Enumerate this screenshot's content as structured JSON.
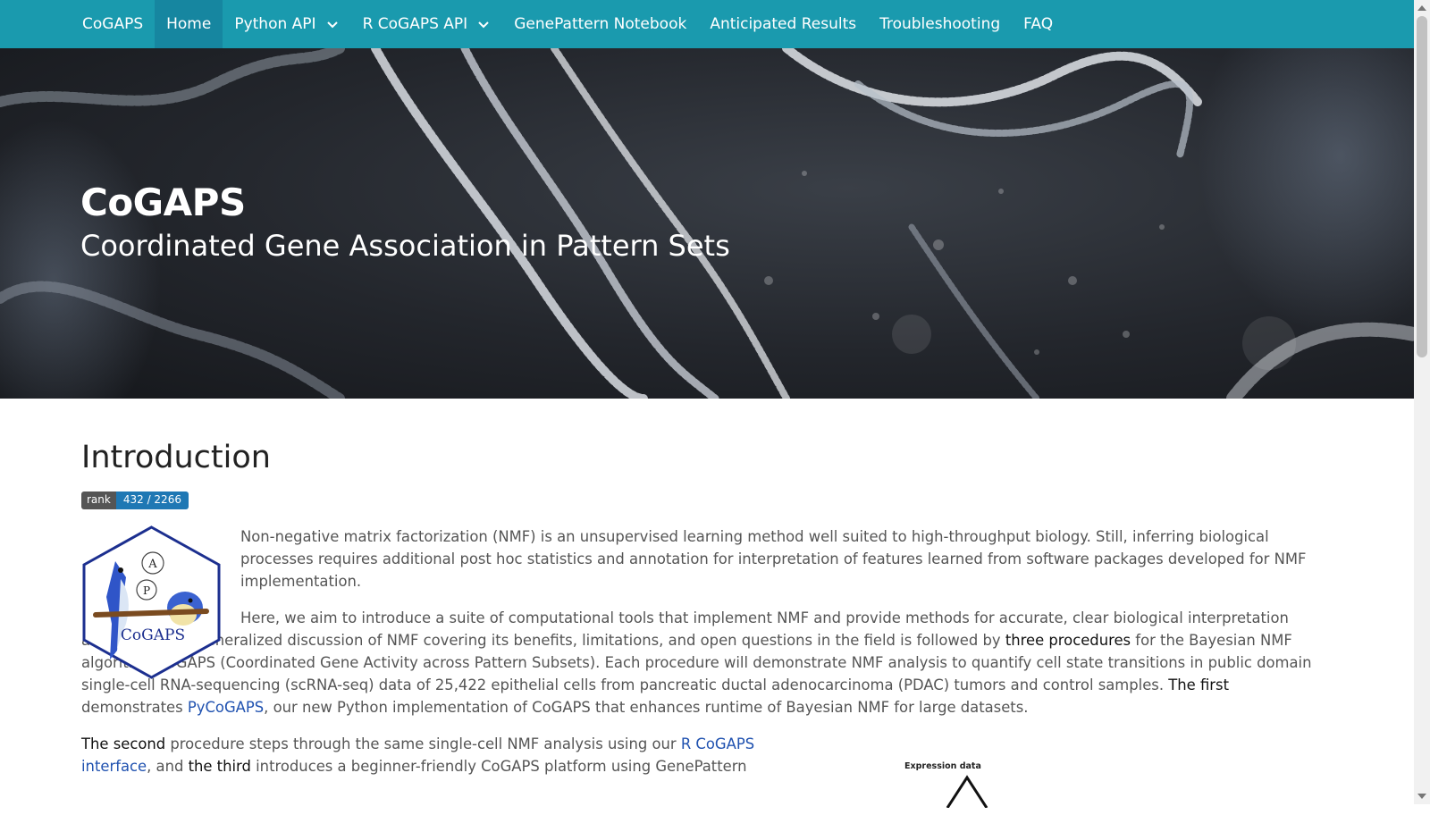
{
  "nav": {
    "brand": "CoGAPS",
    "items": [
      {
        "label": "Home",
        "active": true
      },
      {
        "label": "Python API",
        "dropdown": true
      },
      {
        "label": "R CoGAPS API",
        "dropdown": true
      },
      {
        "label": "GenePattern Notebook"
      },
      {
        "label": "Anticipated Results"
      },
      {
        "label": "Troubleshooting"
      },
      {
        "label": "FAQ"
      }
    ]
  },
  "hero": {
    "title": "CoGAPS",
    "subtitle": "Coordinated Gene Association in Pattern Sets"
  },
  "intro": {
    "heading": "Introduction",
    "badge_label": "rank",
    "badge_value": "432 / 2266",
    "logo_text": "CoGAPS",
    "logo_letters": [
      "A",
      "P"
    ],
    "p1": "Non-negative matrix factorization (NMF) is an unsupervised learning method well suited to high-throughput biology. Still, inferring biological processes requires additional post hoc statistics and annotation for interpretation of features learned from software packages developed for NMF implementation.",
    "p2_a": "Here, we aim to introduce a suite of computational tools that implement NMF and provide methods for accurate, clear biological interpretation and analysis. A generalized discussion of NMF covering its benefits, limitations, and open questions in the field is followed by ",
    "p2_b": "three procedures",
    "p2_c": " for the Bayesian NMF algorithm CoGAPS (Coordinated Gene Activity across Pattern Subsets). Each procedure will demonstrate NMF analysis to quantify cell state transitions in public domain single-cell RNA-sequencing (scRNA-seq) data of 25,422 epithelial cells from pancreatic ductal adenocarcinoma (PDAC) tumors and control samples. ",
    "p2_d": "The first",
    "p2_e": " demonstrates ",
    "p2_link": "PyCoGAPS",
    "p2_f": ", our new Python implementation of CoGAPS that enhances runtime of Bayesian NMF for large datasets.",
    "p3_a": "The second",
    "p3_b": " procedure steps through the same single-cell NMF analysis using our ",
    "p3_link": "R CoGAPS interface",
    "p3_c": ", and ",
    "p3_d": "the third",
    "p3_e": " introduces a beginner-friendly CoGAPS platform using GenePattern",
    "diagram_label": "Expression data"
  },
  "colors": {
    "navbar": "#1a9aae",
    "navbar_active": "#1686a0",
    "link": "#2052b0",
    "badge_right": "#1f78b4"
  }
}
